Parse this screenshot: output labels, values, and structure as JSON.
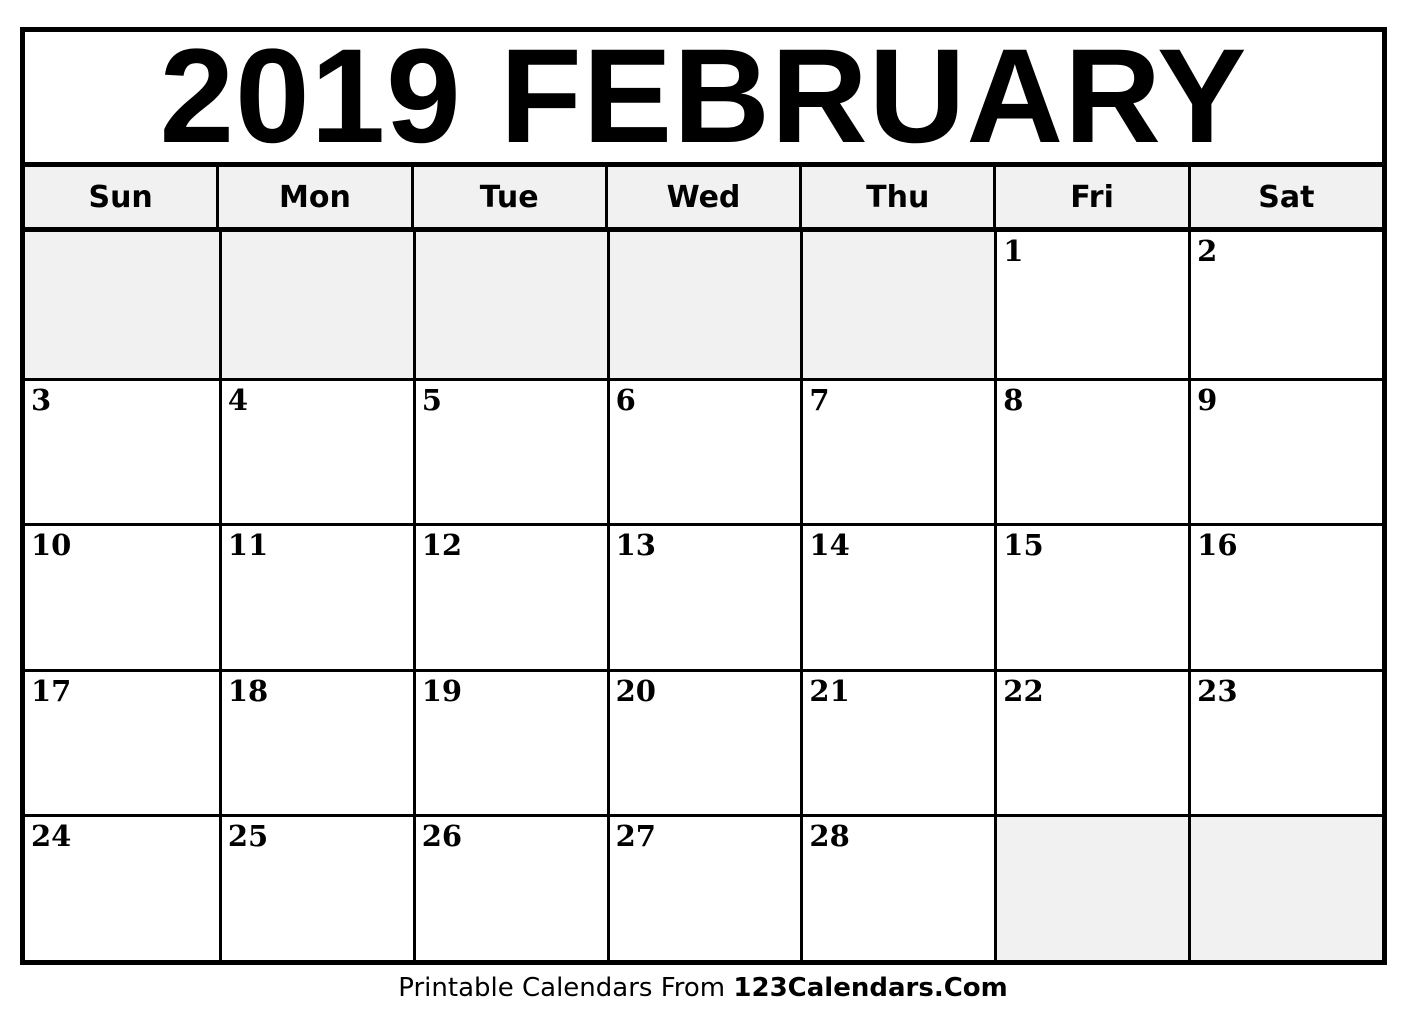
{
  "title": "2019 FEBRUARY",
  "weekdays": [
    "Sun",
    "Mon",
    "Tue",
    "Wed",
    "Thu",
    "Fri",
    "Sat"
  ],
  "weeks": [
    [
      "",
      "",
      "",
      "",
      "",
      "1",
      "2"
    ],
    [
      "3",
      "4",
      "5",
      "6",
      "7",
      "8",
      "9"
    ],
    [
      "10",
      "11",
      "12",
      "13",
      "14",
      "15",
      "16"
    ],
    [
      "17",
      "18",
      "19",
      "20",
      "21",
      "22",
      "23"
    ],
    [
      "24",
      "25",
      "26",
      "27",
      "28",
      "",
      ""
    ]
  ],
  "footer": {
    "prefix": "Printable Calendars From ",
    "brand": "123Calendars.Com"
  },
  "colors": {
    "empty_cell": "#f1f1f1",
    "header_bg": "#f1f1f1",
    "border": "#000000"
  }
}
